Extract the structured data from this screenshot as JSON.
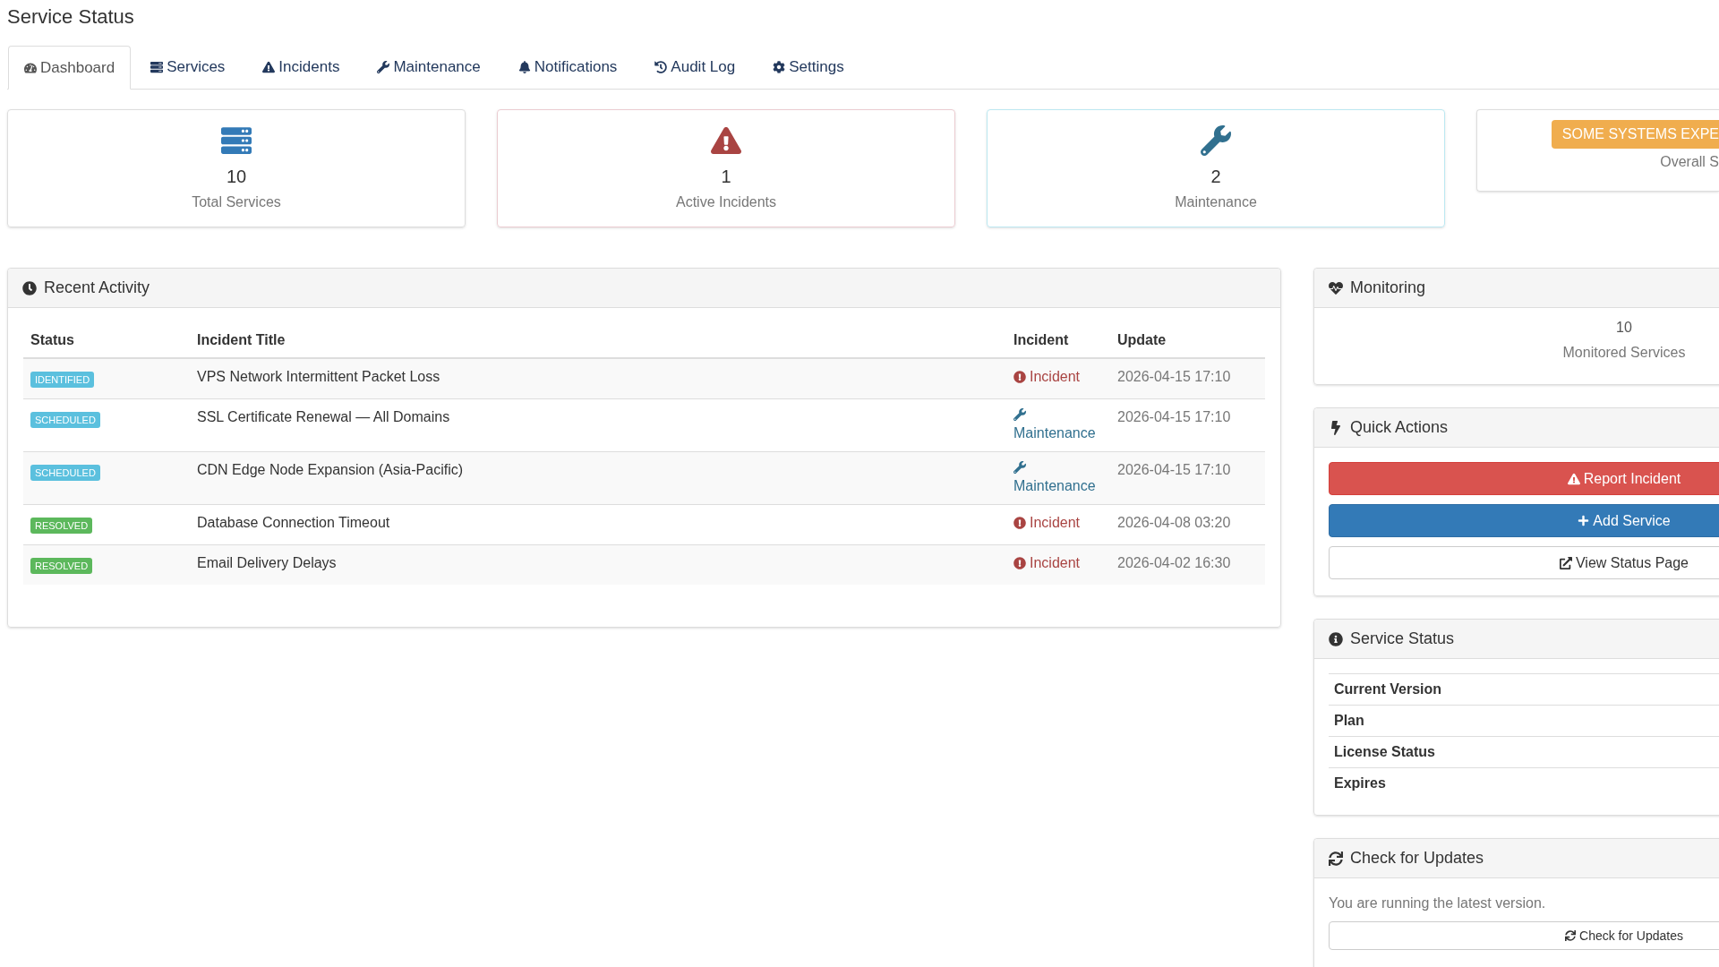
{
  "page": {
    "title": "Service Status"
  },
  "tabs": [
    {
      "label": "Dashboard",
      "selected": true
    },
    {
      "label": "Services",
      "selected": false
    },
    {
      "label": "Incidents",
      "selected": false
    },
    {
      "label": "Maintenance",
      "selected": false
    },
    {
      "label": "Notifications",
      "selected": false
    },
    {
      "label": "Audit Log",
      "selected": false
    },
    {
      "label": "Settings",
      "selected": false
    }
  ],
  "stats": [
    {
      "kind": "services",
      "value": "10",
      "label": "Total Services"
    },
    {
      "kind": "incidents",
      "value": "1",
      "label": "Active Incidents"
    },
    {
      "kind": "maintenance",
      "value": "2",
      "label": "Maintenance"
    },
    {
      "kind": "overall",
      "badge": "SOME SYSTEMS EXPE",
      "label": "Overall S"
    }
  ],
  "recent_activity": {
    "title": "Recent Activity",
    "columns": [
      "Status",
      "Incident Title",
      "Incident",
      "Update"
    ],
    "rows": [
      {
        "status": {
          "label": "IDENTIFIED",
          "kind": "info"
        },
        "title": "VPS Network Intermittent Packet Loss",
        "type": {
          "label": "Incident",
          "kind": "incident"
        },
        "update": "2026-04-15 17:10"
      },
      {
        "status": {
          "label": "SCHEDULED",
          "kind": "info"
        },
        "title": "SSL Certificate Renewal — All Domains",
        "type": {
          "label": "Maintenance",
          "kind": "maintenance"
        },
        "update": "2026-04-15 17:10"
      },
      {
        "status": {
          "label": "SCHEDULED",
          "kind": "info"
        },
        "title": "CDN Edge Node Expansion (Asia-Pacific)",
        "type": {
          "label": "Maintenance",
          "kind": "maintenance"
        },
        "update": "2026-04-15 17:10"
      },
      {
        "status": {
          "label": "RESOLVED",
          "kind": "success"
        },
        "title": "Database Connection Timeout",
        "type": {
          "label": "Incident",
          "kind": "incident"
        },
        "update": "2026-04-08 03:20"
      },
      {
        "status": {
          "label": "RESOLVED",
          "kind": "success"
        },
        "title": "Email Delivery Delays",
        "type": {
          "label": "Incident",
          "kind": "incident"
        },
        "update": "2026-04-02 16:30"
      }
    ]
  },
  "monitoring": {
    "title": "Monitoring",
    "value": "10",
    "label": "Monitored Services"
  },
  "quick_actions": {
    "title": "Quick Actions",
    "buttons": [
      {
        "kind": "danger",
        "label": "Report Incident"
      },
      {
        "kind": "primary",
        "label": "Add Service"
      },
      {
        "kind": "default",
        "label": "View Status Page"
      }
    ]
  },
  "service_status": {
    "title": "Service Status",
    "rows": [
      "Current Version",
      "Plan",
      "License Status",
      "Expires"
    ]
  },
  "updates": {
    "title": "Check for Updates",
    "message": "You are running the latest version.",
    "button": "Check for Updates"
  }
}
